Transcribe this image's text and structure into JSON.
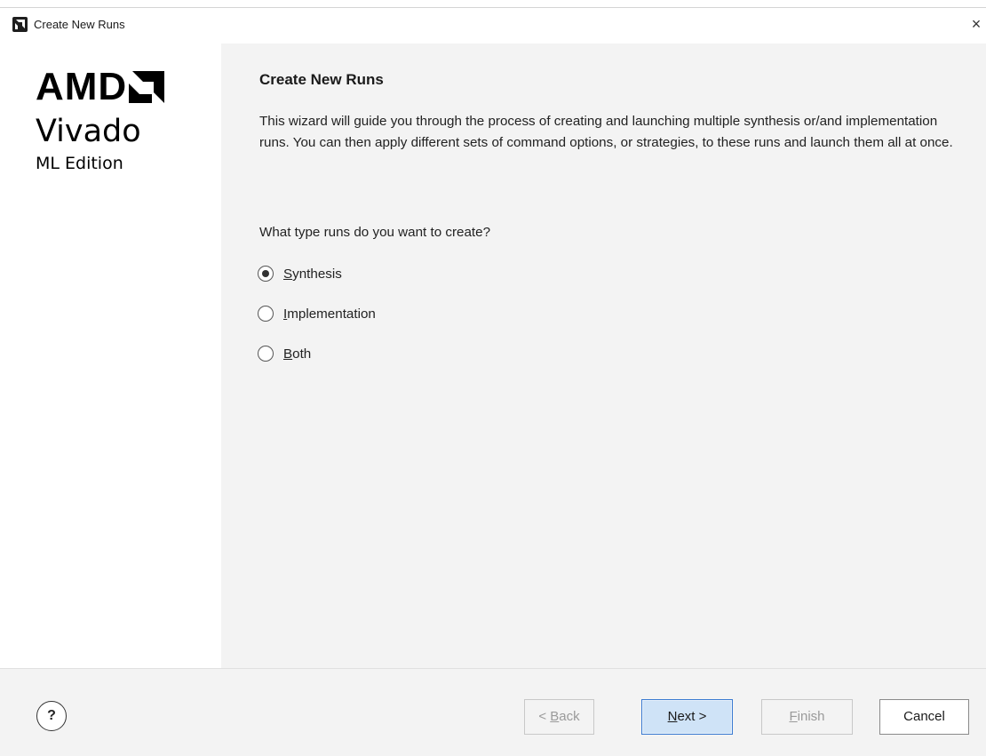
{
  "window": {
    "title": "Create New Runs",
    "close_glyph": "×",
    "app_icon": "amd-icon"
  },
  "sidebar": {
    "brand": "AMD",
    "product": "Vivado",
    "edition": "ML Edition"
  },
  "page": {
    "heading": "Create New Runs",
    "description": "This wizard will guide you through the process of creating and launching multiple synthesis or/and implementation runs. You can then apply different sets of command options, or strategies, to these runs and launch them all at once.",
    "question": "What type runs do you want to create?",
    "options": [
      {
        "mnemonic": "S",
        "rest": "ynthesis",
        "selected": true
      },
      {
        "mnemonic": "I",
        "rest": "mplementation",
        "selected": false
      },
      {
        "mnemonic": "B",
        "rest": "oth",
        "selected": false
      }
    ]
  },
  "footer": {
    "help_label": "?",
    "back": {
      "prefix": "< ",
      "mnemonic": "B",
      "rest": "ack",
      "enabled": false
    },
    "next": {
      "prefix": "",
      "mnemonic": "N",
      "rest": "ext >",
      "enabled": true
    },
    "finish": {
      "prefix": "",
      "mnemonic": "F",
      "rest": "inish",
      "enabled": false
    },
    "cancel": {
      "label": "Cancel",
      "enabled": true
    }
  },
  "colors": {
    "primary_border": "#3b7bd1",
    "primary_fill": "#cfe3f7",
    "panel_bg": "#f3f3f3",
    "sidebar_bg": "#ffffff"
  }
}
